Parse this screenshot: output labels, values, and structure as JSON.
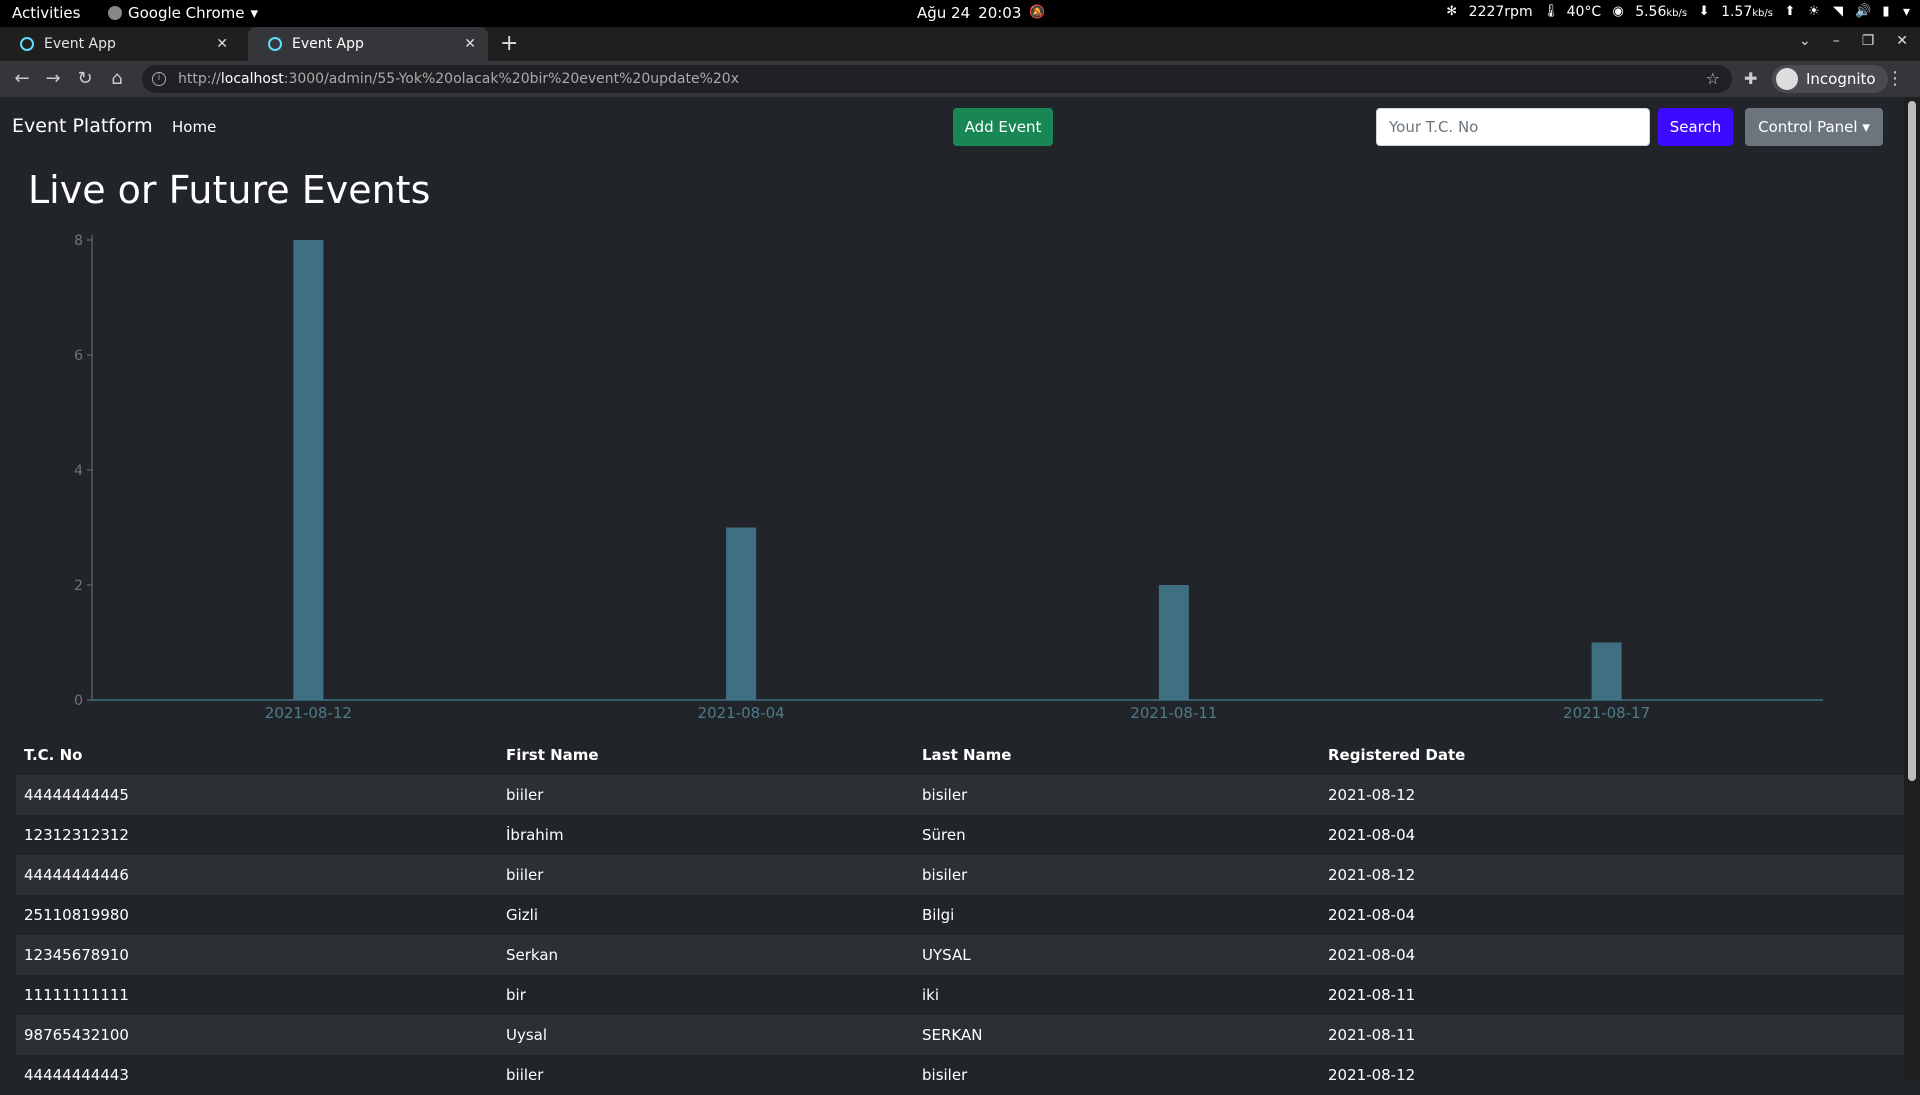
{
  "system_bar": {
    "activities": "Activities",
    "app_name": "Google Chrome",
    "date": "Ağu 24",
    "time": "20:03",
    "fan": "2227rpm",
    "temp": "40°C",
    "down_speed": "5.56",
    "down_unit": "kb/s",
    "up_speed": "1.57",
    "up_unit": "kb/s"
  },
  "browser": {
    "tabs": [
      {
        "title": "Event App"
      },
      {
        "title": "Event App"
      }
    ],
    "url_prefix": "http://",
    "url_host": "localhost",
    "url_rest": ":3000/admin/55-Yok%20olacak%20bir%20event%20update%20x",
    "profile_label": "Incognito"
  },
  "navbar": {
    "brand": "Event Platform",
    "home": "Home",
    "add_event": "Add Event",
    "search_placeholder": "Your T.C. No",
    "search_button": "Search",
    "control_panel": "Control Panel"
  },
  "page": {
    "title": "Live or Future Events"
  },
  "chart_data": {
    "type": "bar",
    "categories": [
      "2021-08-12",
      "2021-08-04",
      "2021-08-11",
      "2021-08-17"
    ],
    "values": [
      8,
      3,
      2,
      1
    ],
    "ylim": [
      0,
      8
    ],
    "yticks": [
      0,
      2,
      4,
      6,
      8
    ],
    "bar_color": "#3e7082"
  },
  "table": {
    "headers": [
      "T.C. No",
      "First Name",
      "Last Name",
      "Registered Date"
    ],
    "rows": [
      [
        "44444444445",
        "biiler",
        "bisiler",
        "2021-08-12"
      ],
      [
        "12312312312",
        "İbrahim",
        "Süren",
        "2021-08-04"
      ],
      [
        "44444444446",
        "biiler",
        "bisiler",
        "2021-08-12"
      ],
      [
        "25110819980",
        "Gizli",
        "Bilgi",
        "2021-08-04"
      ],
      [
        "12345678910",
        "Serkan",
        "UYSAL",
        "2021-08-04"
      ],
      [
        "11111111111",
        "bir",
        "iki",
        "2021-08-11"
      ],
      [
        "98765432100",
        "Uysal",
        "SERKAN",
        "2021-08-11"
      ],
      [
        "44444444443",
        "biiler",
        "bisiler",
        "2021-08-12"
      ]
    ]
  }
}
